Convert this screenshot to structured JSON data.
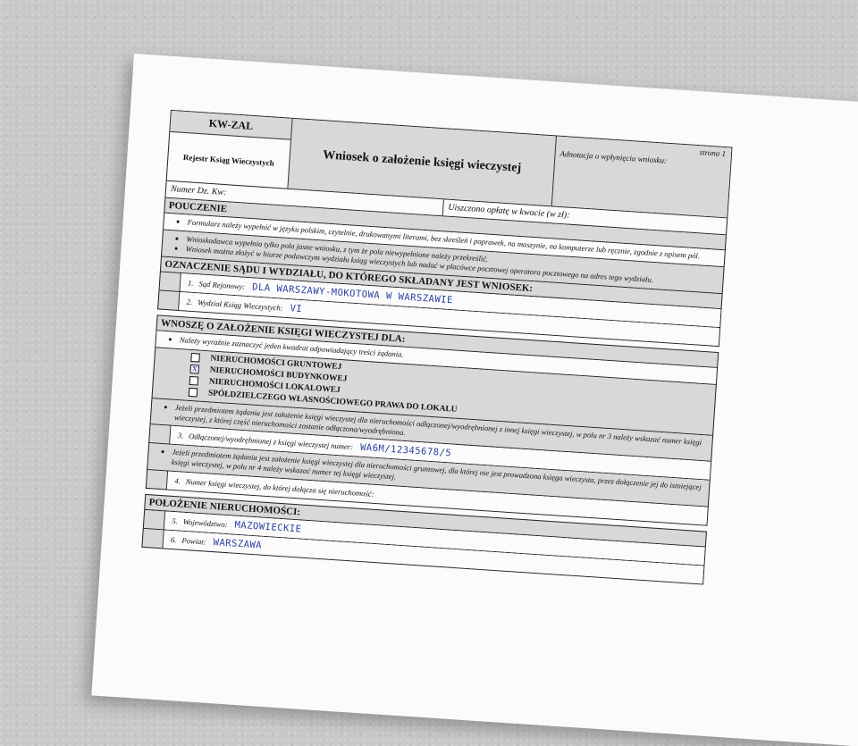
{
  "form": {
    "code": "KW-ZAL",
    "registry": "Rejestr Ksiąg Wieczystych",
    "title": "Wniosek o założenie księgi wieczystej",
    "page": "strona 1",
    "annotation_label": "Adnotacja o wpłynięciu wniosku:",
    "number_label": "Numer Dz. Kw:",
    "fee_label": "Uiszczono opłatę w kwocie (w zł):"
  },
  "pouczenie": {
    "heading": "POUCZENIE",
    "items": [
      "Formularz należy wypełnić w języku polskim, czytelnie, drukowanymi literami, bez skreśleń i poprawek, na maszynie, na komputerze lub ręcznie, zgodnie z opisem pól.",
      "Wnioskodawca wypełnia tylko pola jasne wniosku, z tym że pola niewypełnione należy przekreślić.",
      "Wniosek można złożyć w biurze podawczym wydziału ksiąg wieczystych lub nadać w placówce pocztowej operatora pocztowego na adres tego wydziału."
    ]
  },
  "court": {
    "heading": "OZNACZENIE SĄDU I WYDZIAŁU, DO KTÓREGO SKŁADANY JEST WNIOSEK:",
    "field1_label": "Sąd Rejonowy:",
    "field1_value": "DLA WARSZAWY-MOKOTOWA W WARSZAWIE",
    "field2_label": "Wydział Ksiąg Wieczystych:",
    "field2_value": "VI"
  },
  "request": {
    "heading": "WNOSZĘ O ZAŁOŻENIE KSIĘGI WIECZYSTEJ DLA:",
    "instruction": "Należy wyraźnie zaznaczyć jeden kwadrat odpowiadający treści żądania.",
    "options": [
      {
        "label": "NIERUCHOMOŚCI GRUNTOWEJ",
        "mark": ""
      },
      {
        "label": "NIERUCHOMOŚCI BUDYNKOWEJ",
        "mark": "X"
      },
      {
        "label": "NIERUCHOMOŚCI LOKALOWEJ",
        "mark": ""
      },
      {
        "label": "SPÓŁDZIELCZEGO WŁASNOŚCIOWEGO PRAWA DO LOKALU",
        "mark": ""
      }
    ],
    "note1": "Jeżeli przedmiotem żądania jest założenie księgi wieczystej dla nieruchomości odłączonej/wyodrębnionej z innej księgi wieczystej, w polu nr 3 należy wskazać numer księgi wieczystej, z której część nieruchomości zostanie odłączona/wyodrębniona.",
    "field3_label": "Odłączonej/wyodrębnionej z księgi wieczystej numer:",
    "field3_value": "WA6M/12345678/5",
    "note2": "Jeżeli przedmiotem żądania jest założenie księgi wieczystej dla nieruchomości gruntowej, dla której nie jest prowadzona księga wieczysta, przez dołączenie jej do istniejącej księgi wieczystej, w polu nr 4 należy wskazać numer tej księgi wieczystej.",
    "field4_label": "Numer księgi wieczystej, do której dołącza się nieruchomość:"
  },
  "location": {
    "heading": "POŁOŻENIE NIERUCHOMOŚCI:",
    "field5_label": "Województwo:",
    "field5_value": "MAZOWIECKIE",
    "field6_label": "Powiat:",
    "field6_value": "WARSZAWA"
  }
}
